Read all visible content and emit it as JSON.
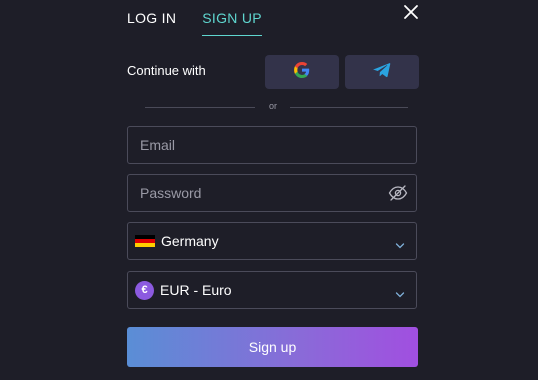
{
  "tabs": {
    "login_label": "LOG IN",
    "signup_label": "SIGN UP",
    "active": "signup"
  },
  "social": {
    "continue_label": "Continue with",
    "google_icon": "google-icon",
    "telegram_icon": "telegram-icon"
  },
  "divider": {
    "or_label": "or"
  },
  "form": {
    "email_placeholder": "Email",
    "password_placeholder": "Password",
    "country_value": "Germany",
    "currency_value": "EUR - Euro",
    "currency_symbol": "€",
    "submit_label": "Sign up"
  },
  "colors": {
    "background": "#1e1e28",
    "accent": "#5fd6cf",
    "social_button": "#33334a",
    "field_border": "#4b4b5a",
    "button_gradient_start": "#5a8ed6",
    "button_gradient_end": "#a14fe0"
  }
}
